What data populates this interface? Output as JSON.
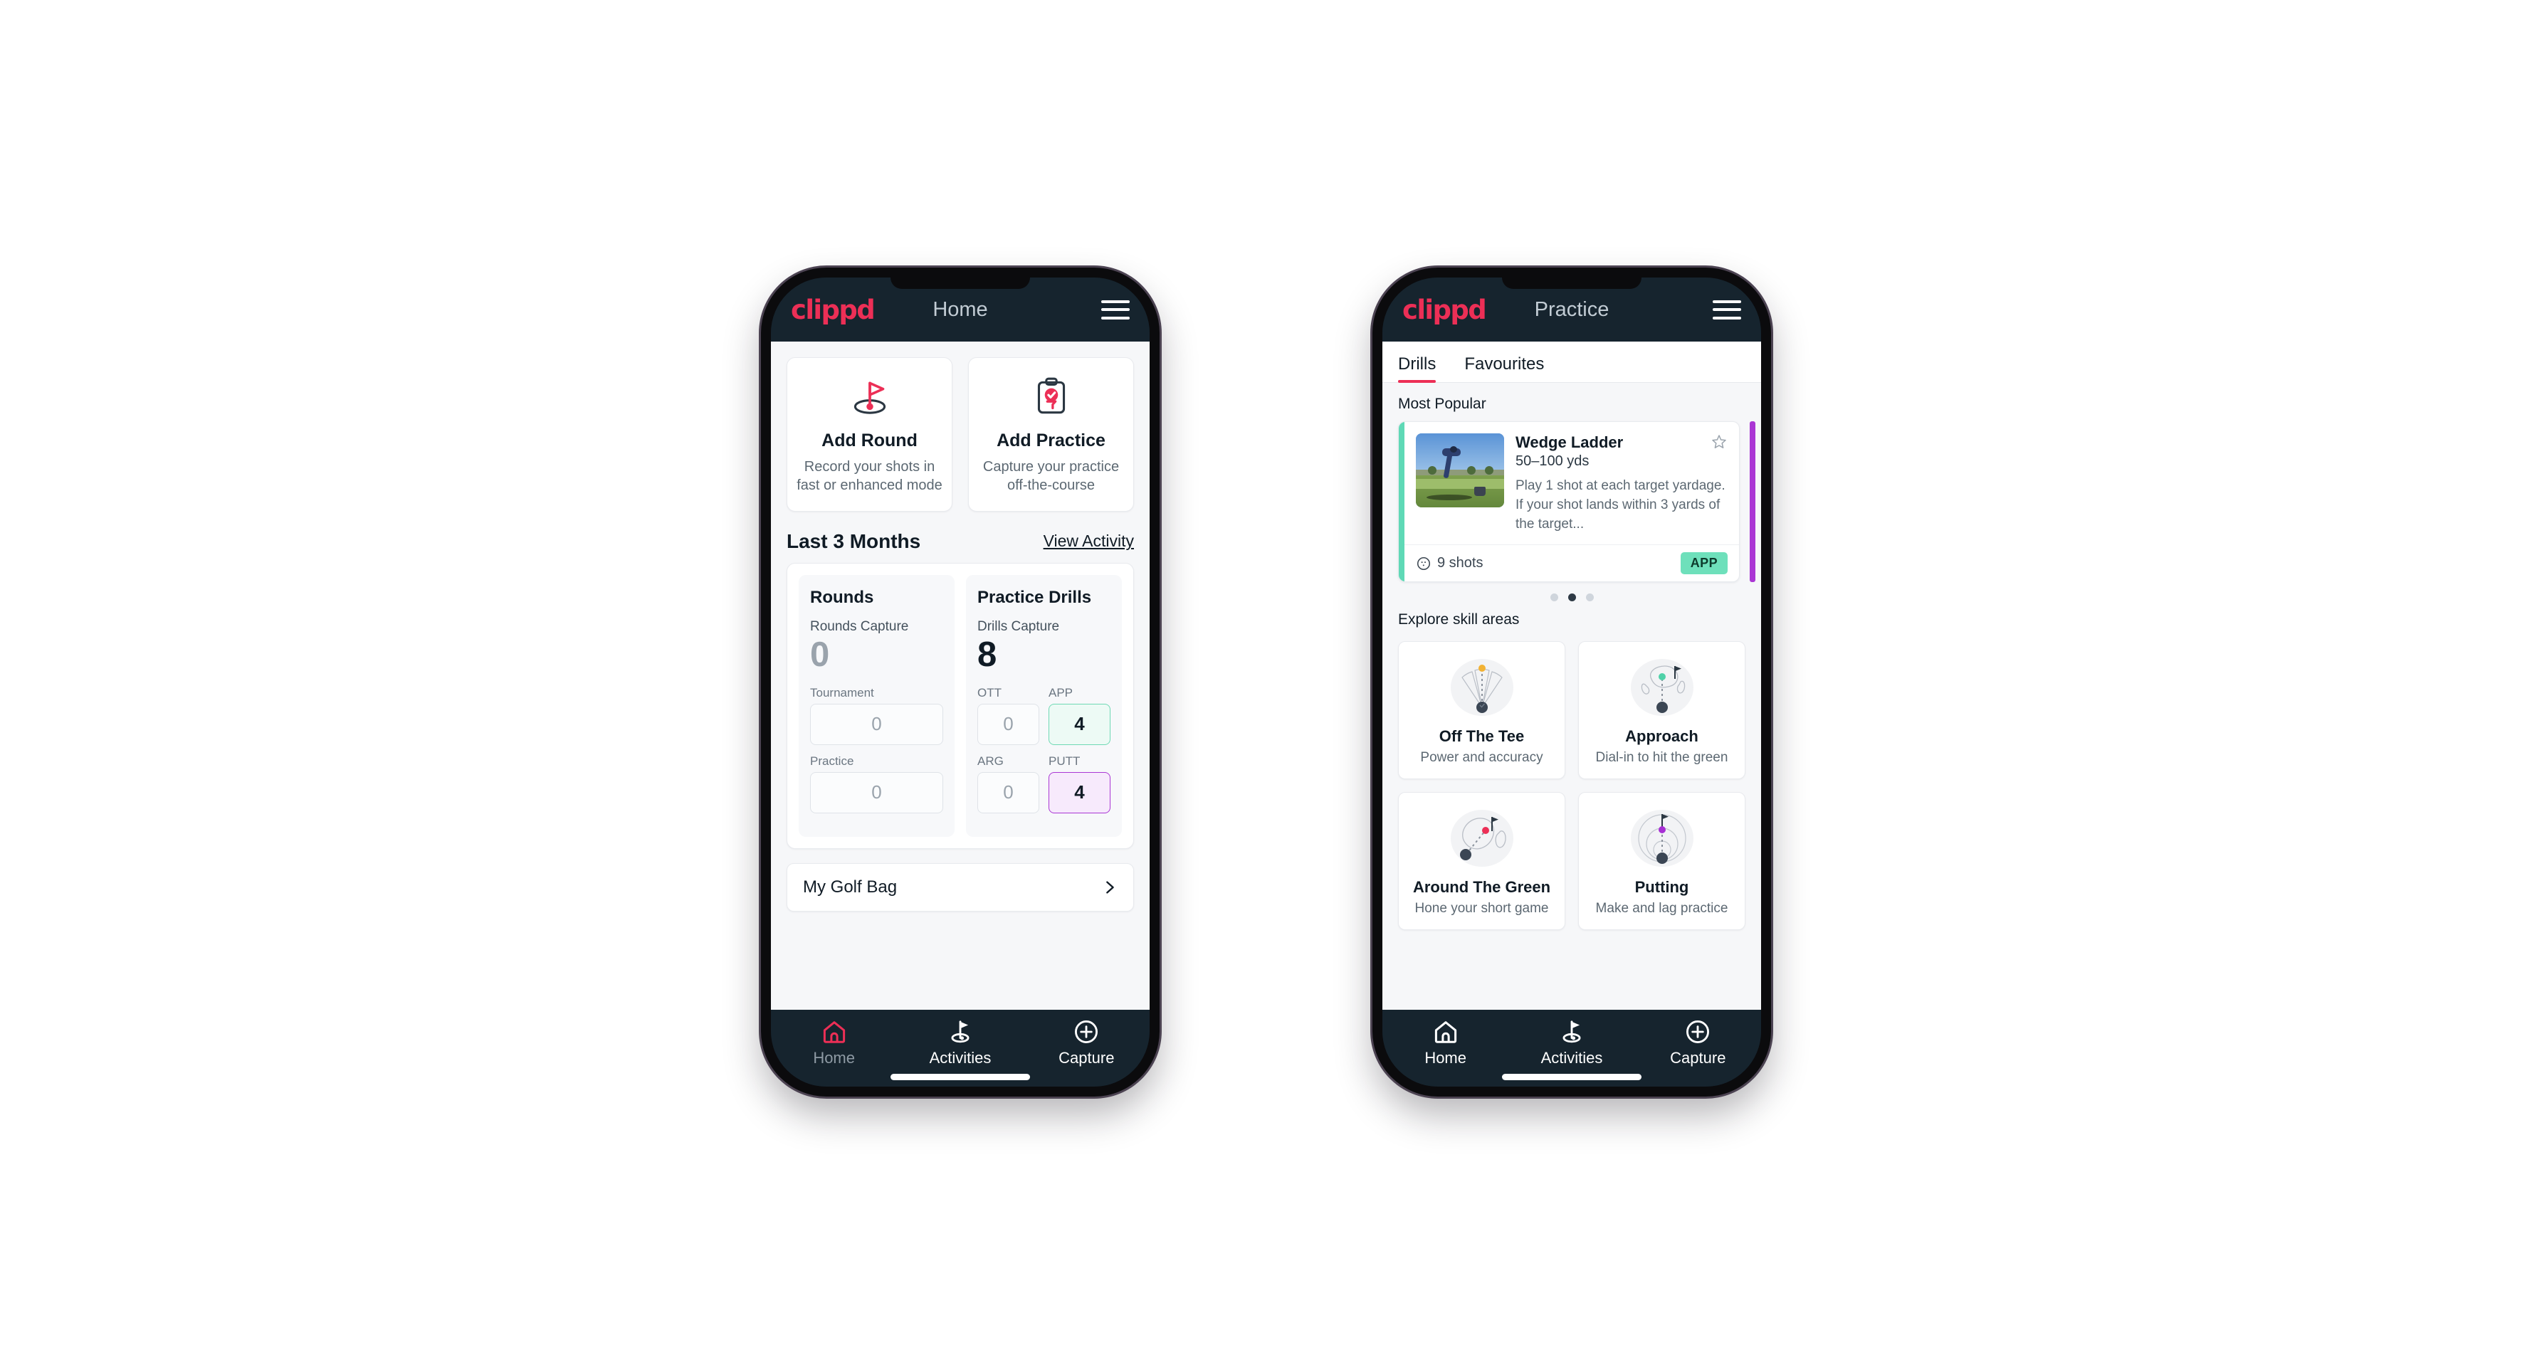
{
  "colors": {
    "brand_pink": "#ec2f56",
    "header_dark": "#16242e",
    "page_bg": "#f6f7f9",
    "accent_teal": "#5fd9b6",
    "accent_purple": "#aa36d4",
    "badge_green": "#6ee0bb"
  },
  "phone_left": {
    "header": {
      "brand": "clippd",
      "title": "Home",
      "menu_icon": "hamburger-menu-icon"
    },
    "quick_actions": [
      {
        "icon": "golf-flag-hole-icon",
        "title": "Add Round",
        "subtitle": "Record your shots in fast or enhanced mode"
      },
      {
        "icon": "clipboard-check-tee-icon",
        "title": "Add Practice",
        "subtitle": "Capture your practice off-the-course"
      }
    ],
    "section": {
      "title": "Last 3 Months",
      "link": "View Activity"
    },
    "stats": {
      "rounds": {
        "heading": "Rounds",
        "capture_label": "Rounds Capture",
        "capture_value": "0",
        "fields": [
          {
            "label": "Tournament",
            "value": "0",
            "state": "empty"
          },
          {
            "label": "Practice",
            "value": "0",
            "state": "empty"
          }
        ]
      },
      "drills": {
        "heading": "Practice Drills",
        "capture_label": "Drills Capture",
        "capture_value": "8",
        "fields": [
          {
            "label": "OTT",
            "value": "0",
            "state": "empty"
          },
          {
            "label": "APP",
            "value": "4",
            "state": "green"
          },
          {
            "label": "ARG",
            "value": "0",
            "state": "empty"
          },
          {
            "label": "PUTT",
            "value": "4",
            "state": "purple"
          }
        ]
      }
    },
    "golf_bag": {
      "label": "My Golf Bag",
      "chevron": "chevron-right-icon"
    },
    "bottom_nav": [
      {
        "icon": "home-icon",
        "label": "Home",
        "active": true
      },
      {
        "icon": "golf-flag-icon",
        "label": "Activities",
        "active": false
      },
      {
        "icon": "plus-circle-icon",
        "label": "Capture",
        "active": false
      }
    ]
  },
  "phone_right": {
    "header": {
      "brand": "clippd",
      "title": "Practice",
      "menu_icon": "hamburger-menu-icon"
    },
    "tabs": [
      {
        "label": "Drills",
        "active": true
      },
      {
        "label": "Favourites",
        "active": false
      }
    ],
    "most_popular_label": "Most Popular",
    "drill": {
      "title": "Wedge Ladder",
      "yardage": "50–100 yds",
      "description": "Play 1 shot at each target yardage. If your shot lands within 3 yards of the target...",
      "shots": "9 shots",
      "shots_icon": "target-circle-icon",
      "badge": "APP",
      "favourite_icon": "star-outline-icon",
      "thumbnail": "golfer-pitching-photo"
    },
    "carousel_dots": {
      "count": 3,
      "active_index": 1
    },
    "skills_label": "Explore skill areas",
    "skills": [
      {
        "icon": "tee-shot-fan-icon",
        "title": "Off The Tee",
        "subtitle": "Power and accuracy",
        "dot_color": "#f2b234"
      },
      {
        "icon": "green-approach-icon",
        "title": "Approach",
        "subtitle": "Dial-in to hit the green",
        "dot_color": "#4fd1a8"
      },
      {
        "icon": "chip-around-green-icon",
        "title": "Around The Green",
        "subtitle": "Hone your short game",
        "dot_color": "#ec2f56"
      },
      {
        "icon": "putting-rings-icon",
        "title": "Putting",
        "subtitle": "Make and lag practice",
        "dot_color": "#a72fd4"
      }
    ],
    "bottom_nav": [
      {
        "icon": "home-icon",
        "label": "Home",
        "active": false
      },
      {
        "icon": "golf-flag-icon",
        "label": "Activities",
        "active": false
      },
      {
        "icon": "plus-circle-icon",
        "label": "Capture",
        "active": false
      }
    ]
  }
}
